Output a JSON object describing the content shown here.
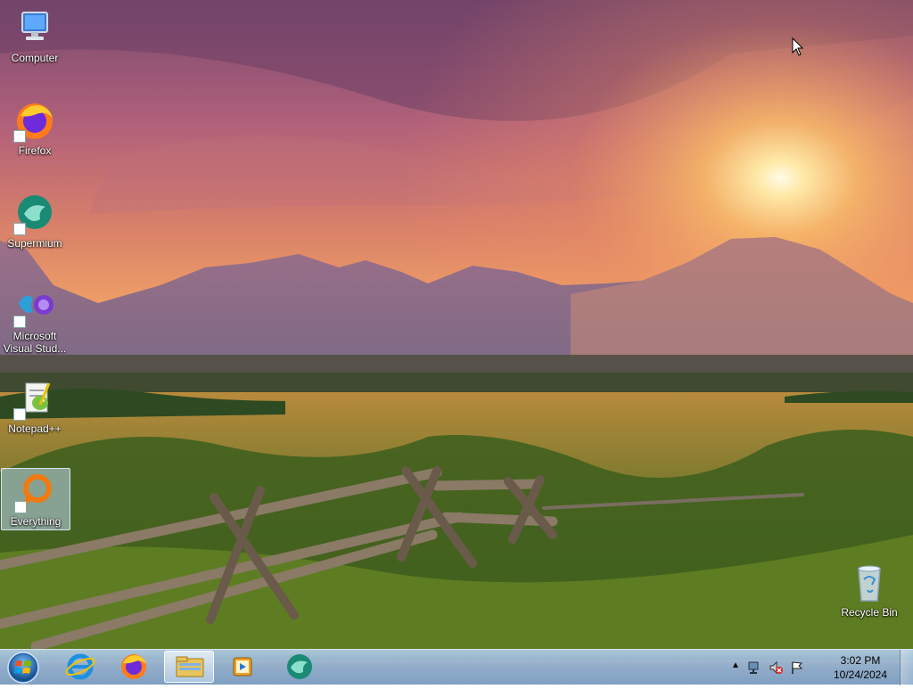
{
  "desktop": {
    "icons": [
      {
        "label": "Computer",
        "icon": "computer-icon"
      },
      {
        "label": "Firefox",
        "icon": "firefox-icon"
      },
      {
        "label": "Supermium",
        "icon": "supermium-icon"
      },
      {
        "label": "Microsoft Visual Stud...",
        "icon": "visual-studio-icon"
      },
      {
        "label": "Notepad++",
        "icon": "notepad-plus-plus-icon"
      },
      {
        "label": "Everything",
        "icon": "everything-search-icon"
      },
      {
        "label": "Recycle Bin",
        "icon": "recycle-bin-icon"
      }
    ]
  },
  "taskbar": {
    "start": {
      "icon": "windows-start-icon"
    },
    "pinned": [
      {
        "name": "Internet Explorer",
        "icon": "internet-explorer-icon"
      },
      {
        "name": "Firefox",
        "icon": "firefox-icon"
      },
      {
        "name": "Windows Explorer",
        "icon": "file-explorer-icon"
      },
      {
        "name": "Media Player",
        "icon": "media-player-icon"
      },
      {
        "name": "Supermium",
        "icon": "supermium-icon"
      }
    ],
    "tray": {
      "icons": [
        "show-hidden-icons-arrow",
        "network-icon",
        "volume-muted-icon",
        "action-center-flag-icon"
      ],
      "time": "3:02 PM",
      "date": "10/24/2024"
    }
  },
  "colors": {
    "taskbar": "#9bbcdc",
    "selection": "#bed7f0"
  }
}
